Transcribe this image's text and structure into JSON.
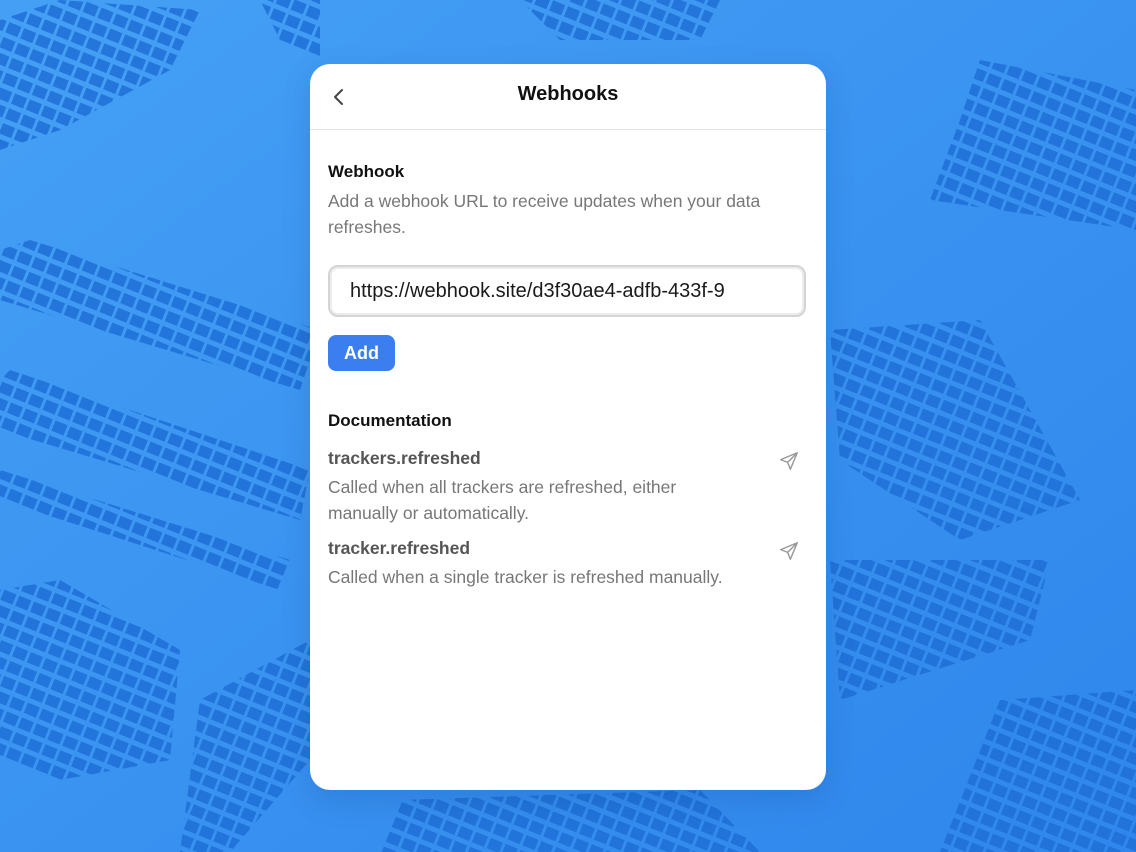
{
  "header": {
    "title": "Webhooks",
    "back_icon": "chevron-left-icon"
  },
  "webhook": {
    "title": "Webhook",
    "description": "Add a webhook URL to receive updates when your data refreshes.",
    "url_value": "https://webhook.site/d3f30ae4-adfb-433f-9",
    "add_label": "Add"
  },
  "documentation": {
    "title": "Documentation",
    "events": [
      {
        "name": "trackers.refreshed",
        "description": "Called when all trackers are refreshed, either manually or automatically.",
        "icon": "send-icon"
      },
      {
        "name": "tracker.refreshed",
        "description": "Called when a single tracker is refreshed manually.",
        "icon": "send-icon"
      }
    ]
  },
  "colors": {
    "background": "#3a92f0",
    "accent": "#3b7ef0"
  }
}
